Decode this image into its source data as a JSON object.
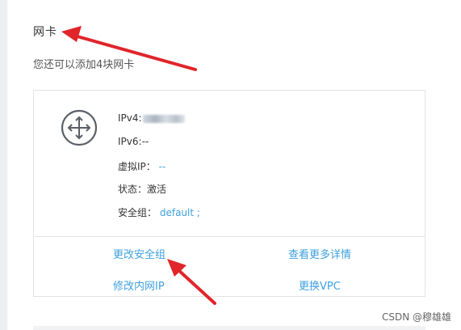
{
  "section": {
    "title": "网卡",
    "description": "您还可以添加4块网卡"
  },
  "nic": {
    "icon": "network-interface-icon",
    "ipv4_label": "IPv4:",
    "ipv6_label": "IPv6:",
    "ipv6_value": "--",
    "virtual_ip_label": "虚拟IP：",
    "virtual_ip_value": "--",
    "status_label": "状态：",
    "status_value": "激活",
    "security_group_label": "安全组：",
    "security_group_value": "default ;"
  },
  "actions": {
    "change_security_group": "更改安全组",
    "view_more_details": "查看更多详情",
    "modify_private_ip": "修改内网IP",
    "change_vpc": "更换VPC"
  },
  "watermark": "CSDN @穆雄雄",
  "colors": {
    "link": "#3ea0de",
    "annotation_arrow": "#e0252b"
  }
}
